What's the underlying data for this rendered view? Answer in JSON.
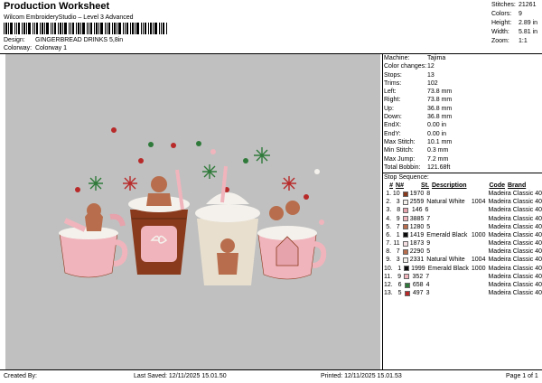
{
  "header": {
    "title": "Production Worksheet",
    "subtitle": "Wilcom EmbroideryStudio – Level 3 Advanced",
    "design_label": "Design:",
    "design_value": "GINGERBREAD DRINKS 5,8in",
    "colorway_label": "Colorway:",
    "colorway_value": "Colorway 1"
  },
  "stats": [
    {
      "k": "Stitches:",
      "v": "21261"
    },
    {
      "k": "Colors:",
      "v": "9"
    },
    {
      "k": "Height:",
      "v": "2.89 in"
    },
    {
      "k": "Width:",
      "v": "5.81 in"
    },
    {
      "k": "Zoom:",
      "v": "1:1"
    }
  ],
  "machine_info": [
    {
      "k": "Machine:",
      "v": "Tajima"
    },
    {
      "k": "Color changes:",
      "v": "12"
    },
    {
      "k": "Stops:",
      "v": "13"
    },
    {
      "k": "Trims:",
      "v": "102"
    },
    {
      "k": "Left:",
      "v": "73.8 mm"
    },
    {
      "k": "Right:",
      "v": "73.8 mm"
    },
    {
      "k": "Up:",
      "v": "36.8 mm"
    },
    {
      "k": "Down:",
      "v": "36.8 mm"
    },
    {
      "k": "EndX:",
      "v": "0.00 in"
    },
    {
      "k": "EndY:",
      "v": "0.00 in"
    },
    {
      "k": "Max Stitch:",
      "v": "10.1 mm"
    },
    {
      "k": "Min Stitch:",
      "v": "0.3 mm"
    },
    {
      "k": "Max Jump:",
      "v": "7.2 mm"
    },
    {
      "k": "Total Bobbin:",
      "v": "121.68ft"
    }
  ],
  "stop_sequence": {
    "title": "Stop Sequence:",
    "headers": {
      "num": "#",
      "n": "N#",
      "st": "St.",
      "desc": "Description",
      "code": "Code",
      "brand": "Brand"
    },
    "rows": [
      {
        "num": "1.",
        "n": "10",
        "color": "#8a3a1c",
        "st": "1970",
        "desc": "8",
        "code": "",
        "brand": "Madeira Classic 40"
      },
      {
        "num": "2.",
        "n": "3",
        "color": "#f4f1ec",
        "st": "2559",
        "desc": "Natural White",
        "code": "1004",
        "brand": "Madeira Classic 40"
      },
      {
        "num": "3.",
        "n": "8",
        "color": "#e6a3ac",
        "st": "146",
        "desc": "6",
        "code": "",
        "brand": "Madeira Classic 40"
      },
      {
        "num": "4.",
        "n": "9",
        "color": "#f0b4bc",
        "st": "3885",
        "desc": "7",
        "code": "",
        "brand": "Madeira Classic 40"
      },
      {
        "num": "5.",
        "n": "7",
        "color": "#b86e4c",
        "st": "1280",
        "desc": "5",
        "code": "",
        "brand": "Madeira Classic 40"
      },
      {
        "num": "6.",
        "n": "1",
        "color": "#0b0b0b",
        "st": "1419",
        "desc": "Emerald Black",
        "code": "1000",
        "brand": "Madeira Classic 40"
      },
      {
        "num": "7.",
        "n": "11",
        "color": "#f6dfe2",
        "st": "1873",
        "desc": "9",
        "code": "",
        "brand": "Madeira Classic 40"
      },
      {
        "num": "8.",
        "n": "7",
        "color": "#b86e4c",
        "st": "2290",
        "desc": "5",
        "code": "",
        "brand": "Madeira Classic 40"
      },
      {
        "num": "9.",
        "n": "3",
        "color": "#f4f1ec",
        "st": "2331",
        "desc": "Natural White",
        "code": "1004",
        "brand": "Madeira Classic 40"
      },
      {
        "num": "10.",
        "n": "1",
        "color": "#0b0b0b",
        "st": "1999",
        "desc": "Emerald Black",
        "code": "1000",
        "brand": "Madeira Classic 40"
      },
      {
        "num": "11.",
        "n": "9",
        "color": "#f0b4bc",
        "st": "352",
        "desc": "7",
        "code": "",
        "brand": "Madeira Classic 40"
      },
      {
        "num": "12.",
        "n": "6",
        "color": "#2f7a3a",
        "st": "658",
        "desc": "4",
        "code": "",
        "brand": "Madeira Classic 40"
      },
      {
        "num": "13.",
        "n": "5",
        "color": "#b82a2a",
        "st": "497",
        "desc": "3",
        "code": "",
        "brand": "Madeira Classic 40"
      }
    ]
  },
  "footer": {
    "created": "Created By:",
    "last_saved": "Last Saved: 12/11/2025 15.01.50",
    "printed": "Printed: 12/11/2025 15.01.53",
    "page": "Page 1 of 1"
  }
}
